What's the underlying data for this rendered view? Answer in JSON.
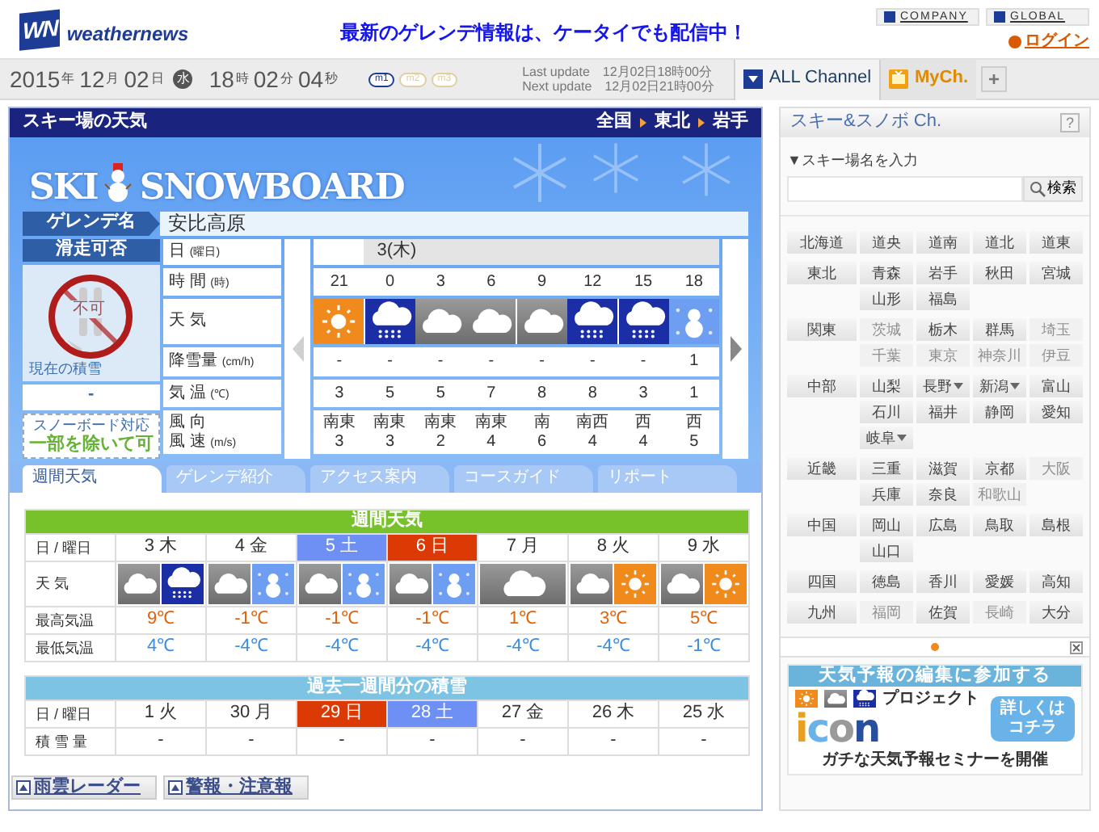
{
  "header": {
    "logo_mark": "WN",
    "logo_text": "weathernews",
    "promo": "最新のゲレンデ情報は、ケータイでも配信中！",
    "links": [
      "COMPANY",
      "GLOBAL"
    ],
    "login": "ログイン"
  },
  "datebar": {
    "date": [
      {
        "text": "2015",
        "kind": "num"
      },
      {
        "text": "年",
        "kind": "unit"
      },
      {
        "text": "12",
        "kind": "num"
      },
      {
        "text": "月",
        "kind": "unit"
      },
      {
        "text": "02",
        "kind": "num"
      },
      {
        "text": "日",
        "kind": "unit"
      },
      {
        "text": "水",
        "kind": "weekday"
      },
      {
        "text": "18",
        "kind": "num"
      },
      {
        "text": "時",
        "kind": "unit"
      },
      {
        "text": "02",
        "kind": "num"
      },
      {
        "text": "分",
        "kind": "unit"
      },
      {
        "text": "04",
        "kind": "num"
      },
      {
        "text": "秒",
        "kind": "unit"
      }
    ],
    "modes": [
      {
        "label": "m1",
        "selected": true
      },
      {
        "label": "m2",
        "selected": false
      },
      {
        "label": "m3",
        "selected": false
      }
    ],
    "updates": [
      {
        "label": "Last update",
        "value": "12月02日18時00分"
      },
      {
        "label": "Next update",
        "value": "12月02日21時00分"
      }
    ],
    "channels": [
      {
        "label": "ALL Channel",
        "selected": true
      },
      {
        "label": "MyCh.",
        "selected": false
      }
    ],
    "add": "+"
  },
  "panel": {
    "title": "スキー場の天気",
    "breadcrumb": [
      "全国",
      "東北",
      "岩手"
    ],
    "banner": [
      "SKI",
      "SNOWBOARD"
    ],
    "resort_label": "ゲレンデ名",
    "resort": "安比高原",
    "status": {
      "label": "滑走可否",
      "allowed": false,
      "sign": "不可",
      "snow_label": "現在の積雪",
      "snow": "-",
      "board_label": "スノーボード対応",
      "board": "一部を除いて可"
    },
    "hourly": {
      "row_labels": [
        {
          "text": "日",
          "unit": "(曜日)"
        },
        {
          "text": "時 間",
          "unit": "(時)"
        },
        {
          "text": "天 気"
        },
        {
          "text": "降雪量",
          "unit": "(cm/h)"
        },
        {
          "text": "気 温",
          "unit": "(℃)"
        },
        {
          "text": "風 向",
          "text2": "風 速",
          "unit": "(m/s)"
        }
      ],
      "prev_enabled": false,
      "next_enabled": true,
      "day": "3(木)",
      "hours": [
        "21",
        "0",
        "3",
        "6",
        "9",
        "12",
        "15",
        "18"
      ],
      "weather": [
        {
          "kind": "sunny"
        },
        {
          "kind": "snow"
        },
        {
          "kind": "cloudy"
        },
        {
          "kind": "cloudy"
        },
        {
          "kind": "cloudy"
        },
        {
          "kind": "snow"
        },
        {
          "kind": "snow"
        },
        {
          "kind": "snow_light"
        }
      ],
      "snowfall": [
        "-",
        "-",
        "-",
        "-",
        "-",
        "-",
        "-",
        "1"
      ],
      "temps": [
        "3",
        "5",
        "5",
        "7",
        "8",
        "8",
        "3",
        "1"
      ],
      "wind": [
        {
          "dir": "南東",
          "speed": "3"
        },
        {
          "dir": "南東",
          "speed": "3"
        },
        {
          "dir": "南東",
          "speed": "2"
        },
        {
          "dir": "南東",
          "speed": "4"
        },
        {
          "dir": "南",
          "speed": "6"
        },
        {
          "dir": "南西",
          "speed": "4"
        },
        {
          "dir": "西",
          "speed": "4"
        },
        {
          "dir": "西",
          "speed": "5"
        }
      ]
    },
    "tabs": [
      {
        "label": "週間天気",
        "selected": true
      },
      {
        "label": "ゲレンデ紹介",
        "selected": false
      },
      {
        "label": "アクセス案内",
        "selected": false
      },
      {
        "label": "コースガイド",
        "selected": false
      },
      {
        "label": "リポート",
        "selected": false
      }
    ],
    "weekly": {
      "title": "週間天気",
      "header_label": "日 / 曜日",
      "weather_label": "天 気",
      "max_label": "最高気温",
      "min_label": "最低気温",
      "days": [
        {
          "day": "3",
          "weekday": "木",
          "kind": "weekday"
        },
        {
          "day": "4",
          "weekday": "金",
          "kind": "weekday"
        },
        {
          "day": "5",
          "weekday": "土",
          "kind": "saturday"
        },
        {
          "day": "6",
          "weekday": "日",
          "kind": "sunday"
        },
        {
          "day": "7",
          "weekday": "月",
          "kind": "weekday"
        },
        {
          "day": "8",
          "weekday": "火",
          "kind": "weekday"
        },
        {
          "day": "9",
          "weekday": "水",
          "kind": "weekday"
        }
      ],
      "weather": [
        [
          {
            "kind": "cloudy"
          },
          {
            "kind": "snow"
          }
        ],
        [
          {
            "kind": "cloudy"
          },
          {
            "kind": "snow_light"
          }
        ],
        [
          {
            "kind": "cloudy"
          },
          {
            "kind": "snow_light"
          }
        ],
        [
          {
            "kind": "cloudy"
          },
          {
            "kind": "snow_light"
          }
        ],
        [
          {
            "kind": "cloudy"
          }
        ],
        [
          {
            "kind": "cloudy"
          },
          {
            "kind": "sunny"
          }
        ],
        [
          {
            "kind": "cloudy"
          },
          {
            "kind": "sunny"
          }
        ]
      ],
      "max": [
        "9℃",
        "-1℃",
        "-1℃",
        "-1℃",
        "1℃",
        "3℃",
        "5℃"
      ],
      "min": [
        "4℃",
        "-4℃",
        "-4℃",
        "-4℃",
        "-4℃",
        "-4℃",
        "-1℃"
      ]
    },
    "past": {
      "title": "過去一週間分の積雪",
      "header_label": "日 / 曜日",
      "amount_label": "積 雪 量",
      "days": [
        {
          "day": "1",
          "weekday": "火",
          "kind": "weekday"
        },
        {
          "day": "30",
          "weekday": "月",
          "kind": "weekday"
        },
        {
          "day": "29",
          "weekday": "日",
          "kind": "sunday"
        },
        {
          "day": "28",
          "weekday": "土",
          "kind": "saturday"
        },
        {
          "day": "27",
          "weekday": "金",
          "kind": "weekday"
        },
        {
          "day": "26",
          "weekday": "木",
          "kind": "weekday"
        },
        {
          "day": "25",
          "weekday": "水",
          "kind": "weekday"
        }
      ],
      "amounts": [
        "-",
        "-",
        "-",
        "-",
        "-",
        "-",
        "-"
      ]
    },
    "links": [
      "雨雲レーダー",
      "警報・注意報"
    ]
  },
  "sidebar": {
    "title": "スキー&スノボ Ch.",
    "help": "?",
    "search_label": "▼スキー場名を入力",
    "search_button": "検索",
    "regions": [
      {
        "name": "北海道",
        "areas": [
          {
            "name": "道央",
            "enabled": true,
            "menu": false
          },
          {
            "name": "道南",
            "enabled": true,
            "menu": false
          },
          {
            "name": "道北",
            "enabled": true,
            "menu": false
          },
          {
            "name": "道東",
            "enabled": true,
            "menu": false
          }
        ]
      },
      {
        "name": "東北",
        "areas": [
          {
            "name": "青森",
            "enabled": true,
            "menu": false
          },
          {
            "name": "岩手",
            "enabled": true,
            "menu": false
          },
          {
            "name": "秋田",
            "enabled": true,
            "menu": false
          },
          {
            "name": "宮城",
            "enabled": true,
            "menu": false
          },
          {
            "name": "山形",
            "enabled": true,
            "menu": false
          },
          {
            "name": "福島",
            "enabled": true,
            "menu": false
          }
        ]
      },
      {
        "name": "関東",
        "areas": [
          {
            "name": "茨城",
            "enabled": false,
            "menu": false
          },
          {
            "name": "栃木",
            "enabled": true,
            "menu": false
          },
          {
            "name": "群馬",
            "enabled": true,
            "menu": false
          },
          {
            "name": "埼玉",
            "enabled": false,
            "menu": false
          },
          {
            "name": "千葉",
            "enabled": false,
            "menu": false
          },
          {
            "name": "東京",
            "enabled": false,
            "menu": false
          },
          {
            "name": "神奈川",
            "enabled": false,
            "menu": false
          },
          {
            "name": "伊豆",
            "enabled": false,
            "menu": false
          }
        ]
      },
      {
        "name": "中部",
        "areas": [
          {
            "name": "山梨",
            "enabled": true,
            "menu": false
          },
          {
            "name": "長野",
            "enabled": true,
            "menu": true
          },
          {
            "name": "新潟",
            "enabled": true,
            "menu": true
          },
          {
            "name": "富山",
            "enabled": true,
            "menu": false
          },
          {
            "name": "石川",
            "enabled": true,
            "menu": false
          },
          {
            "name": "福井",
            "enabled": true,
            "menu": false
          },
          {
            "name": "静岡",
            "enabled": true,
            "menu": false
          },
          {
            "name": "愛知",
            "enabled": true,
            "menu": false
          },
          {
            "name": "岐阜",
            "enabled": true,
            "menu": true
          }
        ]
      },
      {
        "name": "近畿",
        "areas": [
          {
            "name": "三重",
            "enabled": true,
            "menu": false
          },
          {
            "name": "滋賀",
            "enabled": true,
            "menu": false
          },
          {
            "name": "京都",
            "enabled": true,
            "menu": false
          },
          {
            "name": "大阪",
            "enabled": false,
            "menu": false
          },
          {
            "name": "兵庫",
            "enabled": true,
            "menu": false
          },
          {
            "name": "奈良",
            "enabled": true,
            "menu": false
          },
          {
            "name": "和歌山",
            "enabled": false,
            "menu": false
          }
        ]
      },
      {
        "name": "中国",
        "areas": [
          {
            "name": "岡山",
            "enabled": true,
            "menu": false
          },
          {
            "name": "広島",
            "enabled": true,
            "menu": false
          },
          {
            "name": "鳥取",
            "enabled": true,
            "menu": false
          },
          {
            "name": "島根",
            "enabled": true,
            "menu": false
          },
          {
            "name": "山口",
            "enabled": true,
            "menu": false
          }
        ]
      },
      {
        "name": "四国",
        "areas": [
          {
            "name": "徳島",
            "enabled": true,
            "menu": false
          },
          {
            "name": "香川",
            "enabled": true,
            "menu": false
          },
          {
            "name": "愛媛",
            "enabled": true,
            "menu": false
          },
          {
            "name": "高知",
            "enabled": true,
            "menu": false
          }
        ]
      },
      {
        "name": "九州",
        "areas": [
          {
            "name": "福岡",
            "enabled": false,
            "menu": false
          },
          {
            "name": "佐賀",
            "enabled": true,
            "menu": false
          },
          {
            "name": "長崎",
            "enabled": false,
            "menu": false
          },
          {
            "name": "大分",
            "enabled": true,
            "menu": false
          }
        ]
      }
    ],
    "ad": {
      "headline": "天気予報の編集に参加する",
      "project": "プロジェクト",
      "logo": "icon",
      "cta": [
        "詳しくは",
        "コチラ"
      ],
      "footer": "ガチな天気予報セミナーを開催"
    }
  }
}
